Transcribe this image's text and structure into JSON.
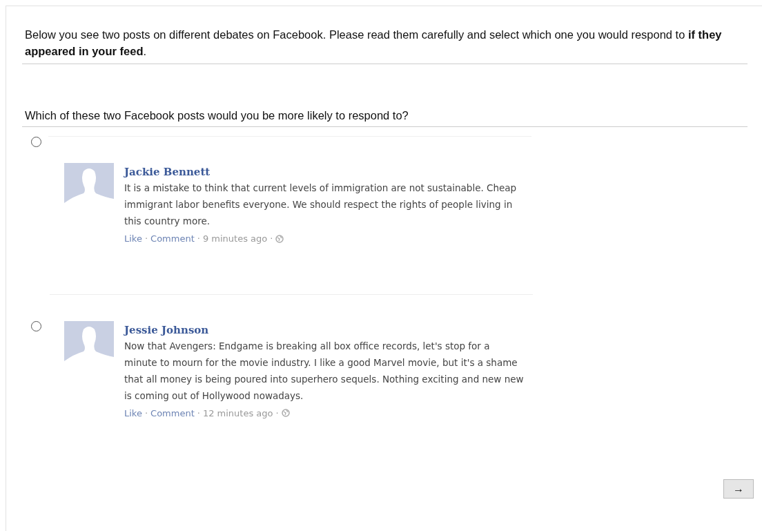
{
  "intro": "Below you see two posts on different debates on Facebook. Please read them carefully and select which one you would respond to **if they appeared in your feed**.",
  "question": "Which of these two Facebook posts would you be more likely to respond to?",
  "options": [
    {
      "selected": false,
      "author": "Jackie Bennett",
      "text": "It is a mistake to think that current levels of immigration are not sustainable. Cheap immigrant labor benefits everyone. We should respect the rights of people living in this country more.",
      "actions": [
        "Like",
        "Comment"
      ],
      "time": "9 minutes ago",
      "separator": "·"
    },
    {
      "selected": false,
      "author": "Jessie Johnson",
      "text": "Now that Avengers: Endgame is breaking all box office records, let's stop for a minute to mourn for the movie industry. I like a good Marvel movie, but it's a shame that all money is being poured into superhero sequels. Nothing exciting and new new is coming out of Hollywood nowadays.",
      "actions": [
        "Like",
        "Comment"
      ],
      "time": "12 minutes ago",
      "separator": "·"
    }
  ],
  "next_button": "→"
}
